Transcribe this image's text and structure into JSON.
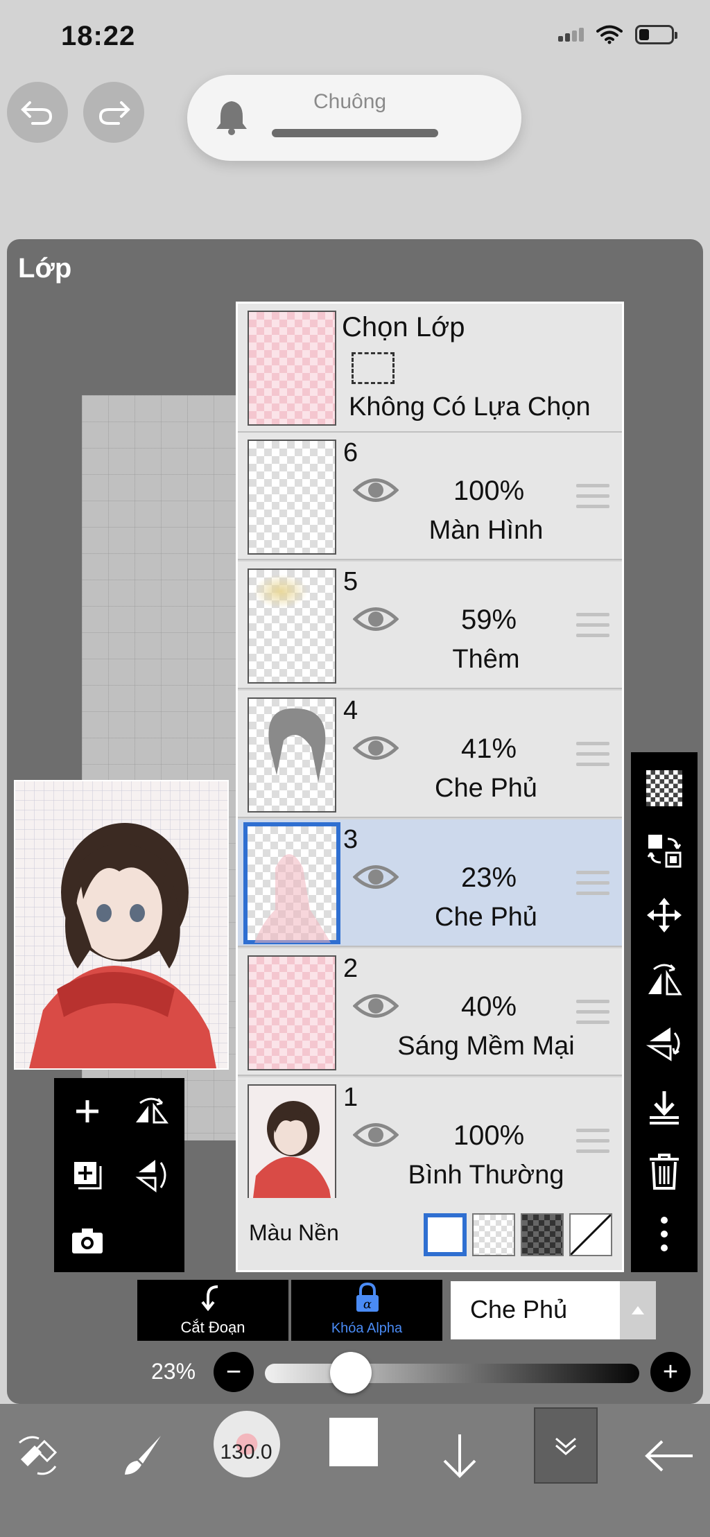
{
  "status": {
    "time": "18:22"
  },
  "notification": {
    "title": "Chuông"
  },
  "panel": {
    "title": "Lớp"
  },
  "selection": {
    "title": "Chọn Lớp",
    "subtitle": "Không Có Lựa Chọn"
  },
  "layers": [
    {
      "number": "6",
      "opacity": "100%",
      "mode": "Màn Hình",
      "thumb": "checker",
      "active": false
    },
    {
      "number": "5",
      "opacity": "59%",
      "mode": "Thêm",
      "thumb": "yellow",
      "active": false
    },
    {
      "number": "4",
      "opacity": "41%",
      "mode": "Che Phủ",
      "thumb": "hair",
      "active": false
    },
    {
      "number": "3",
      "opacity": "23%",
      "mode": "Che Phủ",
      "thumb": "pink-shape",
      "active": true
    },
    {
      "number": "2",
      "opacity": "40%",
      "mode": "Sáng Mềm Mại",
      "thumb": "pink",
      "active": false
    },
    {
      "number": "1",
      "opacity": "100%",
      "mode": "Bình Thường",
      "thumb": "art",
      "active": false
    }
  ],
  "background": {
    "label": "Màu Nền"
  },
  "actions": {
    "clip_label": "Cắt Đoạn",
    "alpha_label": "Khóa Alpha"
  },
  "blend_mode": {
    "value": "Che Phủ"
  },
  "opacity": {
    "label": "23%",
    "value": 23
  },
  "brush": {
    "size": "130.0"
  },
  "colors": {
    "accent": "#2f6fd1",
    "panel": "#6e6e6e",
    "alpha_lock": "#4a8bf5"
  }
}
